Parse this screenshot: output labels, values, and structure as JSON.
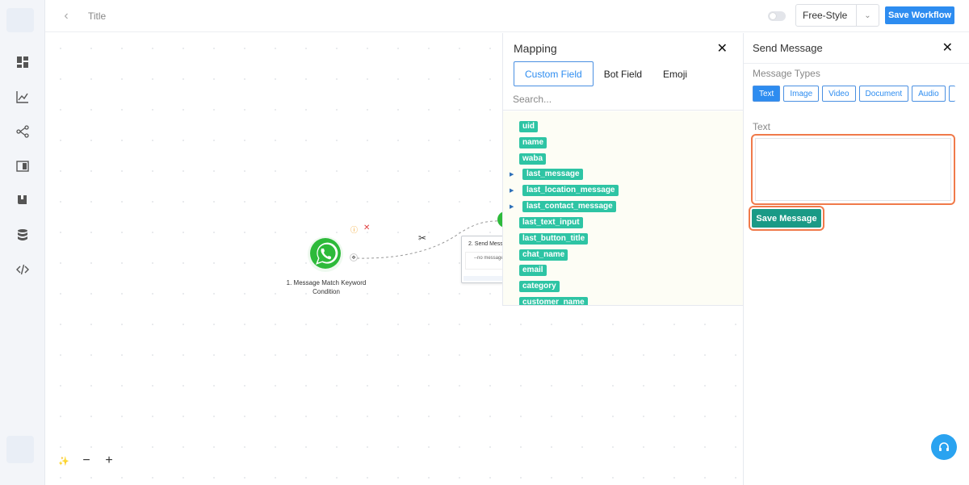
{
  "header": {
    "title": "Title",
    "style_select": {
      "value": "Free-Style"
    },
    "save_workflow_label": "Save Workflow"
  },
  "sidebar": {
    "items": [
      {
        "name": "dashboard-icon"
      },
      {
        "name": "analytics-icon"
      },
      {
        "name": "workflow-icon"
      },
      {
        "name": "layout-icon"
      },
      {
        "name": "book-icon"
      },
      {
        "name": "database-icon"
      },
      {
        "name": "code-icon"
      }
    ]
  },
  "canvas": {
    "node1": {
      "label": "1. Message Match Keyword Condition"
    },
    "node2": {
      "title": "2. Send Mess",
      "body": "--no message"
    }
  },
  "mapping": {
    "title": "Mapping",
    "tabs": [
      "Custom Field",
      "Bot Field",
      "Emoji"
    ],
    "active_tab": "Custom Field",
    "search_placeholder": "Search...",
    "fields": [
      {
        "label": "uid",
        "expandable": false
      },
      {
        "label": "name",
        "expandable": false
      },
      {
        "label": "waba",
        "expandable": false
      },
      {
        "label": "last_message",
        "expandable": true
      },
      {
        "label": "last_location_message",
        "expandable": true
      },
      {
        "label": "last_contact_message",
        "expandable": true
      },
      {
        "label": "last_text_input",
        "expandable": false
      },
      {
        "label": "last_button_title",
        "expandable": false
      },
      {
        "label": "chat_name",
        "expandable": false
      },
      {
        "label": "email",
        "expandable": false
      },
      {
        "label": "category",
        "expandable": false
      },
      {
        "label": "customer_name",
        "expandable": false
      }
    ]
  },
  "send_message": {
    "title": "Send Message",
    "message_types_label": "Message Types",
    "types": [
      "Text",
      "Image",
      "Video",
      "Document",
      "Audio"
    ],
    "active_type": "Text",
    "text_label": "Text",
    "text_value": "",
    "save_label": "Save Message"
  },
  "colors": {
    "primary": "#2d8cf0",
    "field_tag": "#2ec4a4",
    "save_message": "#1a9a86",
    "highlight": "#f07a4a"
  }
}
